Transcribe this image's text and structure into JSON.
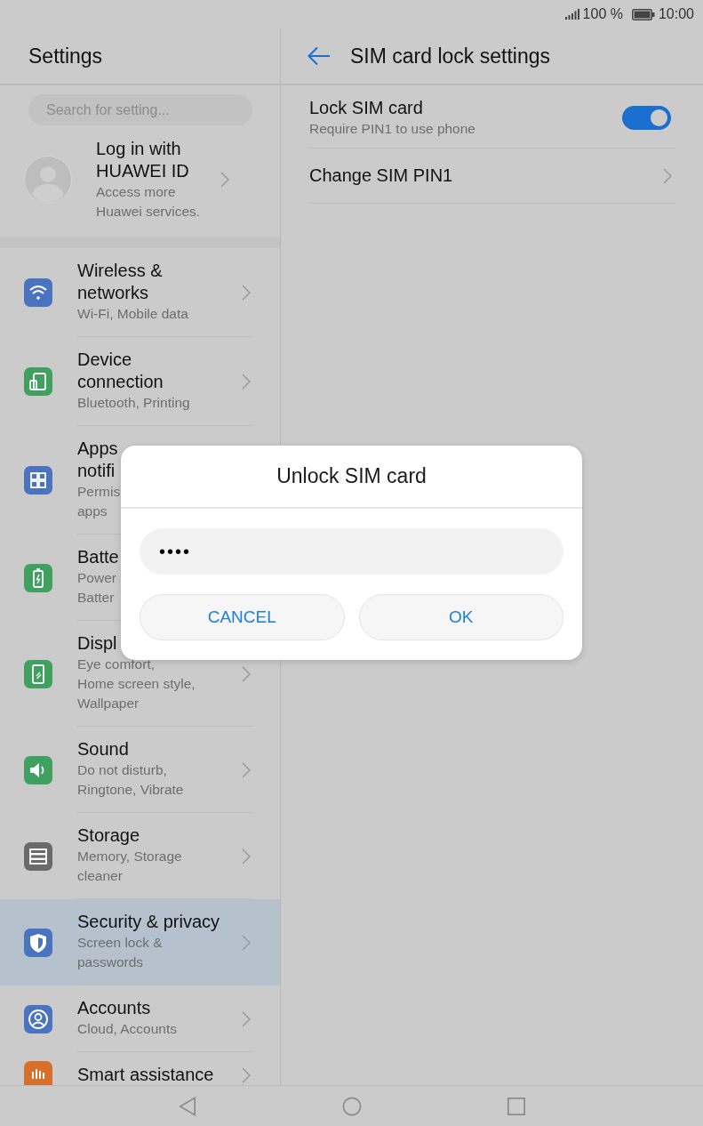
{
  "status_bar": {
    "battery": "100 %",
    "time": "10:00"
  },
  "sidebar": {
    "title": "Settings",
    "search": {
      "placeholder": "Search for setting..."
    },
    "account": {
      "title": "Log in with HUAWEI ID",
      "subtitle": "Access more Huawei services."
    },
    "items": [
      {
        "title": "Wireless & networks",
        "subtitle": "Wi-Fi, Mobile data",
        "selected": false
      },
      {
        "title": "Device connection",
        "subtitle": "Bluetooth, Printing",
        "selected": false
      },
      {
        "title": "Apps\nnotifi",
        "subtitle": "Permis\napps",
        "selected": false
      },
      {
        "title": "Batte",
        "subtitle": "Power\nBatter",
        "selected": false
      },
      {
        "title": "Displ",
        "subtitle": "Eye comfort,\nHome screen style, Wallpaper",
        "selected": false
      },
      {
        "title": "Sound",
        "subtitle": "Do not disturb, Ringtone, Vibrate",
        "selected": false
      },
      {
        "title": "Storage",
        "subtitle": "Memory, Storage cleaner",
        "selected": false
      },
      {
        "title": "Security & privacy",
        "subtitle": "Screen lock & passwords",
        "selected": true
      },
      {
        "title": "Accounts",
        "subtitle": "Cloud, Accounts",
        "selected": false
      },
      {
        "title": "Smart assistance",
        "selected": false
      }
    ]
  },
  "page": {
    "title": "SIM card lock settings",
    "rows": [
      {
        "kind": "toggle",
        "title": "Lock SIM card",
        "subtitle": "Require PIN1 to use phone",
        "on": true
      },
      {
        "kind": "link",
        "title": "Change SIM PIN1"
      }
    ]
  },
  "dialog": {
    "title": "Unlock SIM card",
    "value": "••••",
    "buttons": [
      "CANCEL",
      "OK"
    ]
  }
}
